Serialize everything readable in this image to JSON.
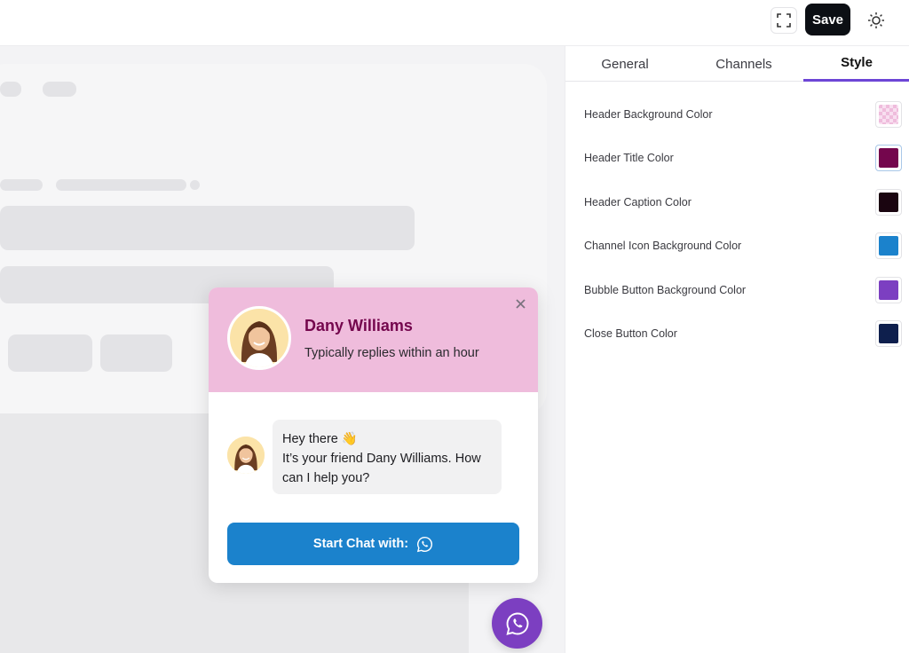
{
  "toolbar": {
    "save_label": "Save",
    "icons": [
      "fullscreen-icon",
      "sun-icon"
    ]
  },
  "widget": {
    "title": "Dany Williams",
    "caption": "Typically replies within an hour",
    "message_line1": "Hey there 👋",
    "message_line2": "It’s your friend Dany Williams. How can I help you?",
    "start_chat_label": "Start Chat with:",
    "icons": [
      "close-icon",
      "whatsapp-icon"
    ]
  },
  "tabs": [
    {
      "label": "General",
      "active": false
    },
    {
      "label": "Channels",
      "active": false
    },
    {
      "label": "Style",
      "active": true
    }
  ],
  "style_settings": [
    {
      "label": "Header Background Color",
      "color": "#efbcdc",
      "transparent": true
    },
    {
      "label": "Header Title Color",
      "color": "#74064d"
    },
    {
      "label": "Header Caption Color",
      "color": "#1a0510"
    },
    {
      "label": "Channel Icon Background Color",
      "color": "#1b82cc"
    },
    {
      "label": "Bubble Button Background Color",
      "color": "#7c3fc1"
    },
    {
      "label": "Close Button Color",
      "color": "#0e1f4d"
    }
  ],
  "colors": {
    "accent": "#6d46d6",
    "start_button": "#1b82cc",
    "fab": "#7c3fc1",
    "header_bg": "#efbcdc",
    "title": "#74064d"
  }
}
